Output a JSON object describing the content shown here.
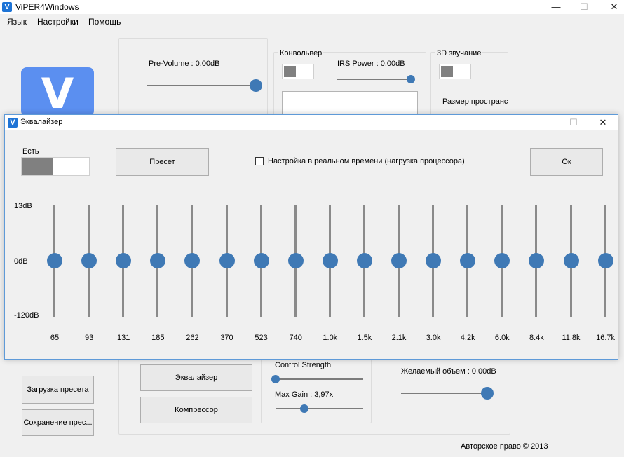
{
  "window": {
    "title": "ViPER4Windows",
    "icon": "V",
    "controls": {
      "minimize": "—",
      "maximize": "☐",
      "close": "✕"
    }
  },
  "menu": [
    "Язык",
    "Настройки",
    "Помощь"
  ],
  "main": {
    "pre_volume_label": "Pre-Volume : 0,00dB",
    "pre_volume_value": 1.0,
    "convolver_label": "Конвольвер",
    "irs_power_label": "IRS Power : 0,00dB",
    "irs_power_value": 1.0,
    "surround_label": "3D звучание",
    "space_size_label": "Размер пространств",
    "control_strength_label": "Control Strength",
    "control_strength_value": 0.0,
    "max_gain_label": "Max Gain : 3,97x",
    "max_gain_value": 0.33,
    "desired_volume_label": "Желаемый объем : 0,00dB",
    "desired_volume_value": 1.0,
    "load_preset_button": "Загрузка пресета",
    "save_preset_button": "Сохранение прес...",
    "equalizer_button": "Эквалайзер",
    "compressor_button": "Компрессор",
    "copyright": "Авторское право © 2013"
  },
  "equalizer": {
    "title": "Эквалайзер",
    "enable_label": "Есть",
    "preset_button": "Пресет",
    "realtime_checkbox_label": "Настройка в реальном времени (нагрузка процессора)",
    "realtime_checked": false,
    "ok_button": "Ок",
    "db_max": "13dB",
    "db_mid": "0dB",
    "db_min": "-120dB",
    "bands": [
      {
        "freq": "65",
        "gain_db": 0
      },
      {
        "freq": "93",
        "gain_db": 0
      },
      {
        "freq": "131",
        "gain_db": 0
      },
      {
        "freq": "185",
        "gain_db": 0
      },
      {
        "freq": "262",
        "gain_db": 0
      },
      {
        "freq": "370",
        "gain_db": 0
      },
      {
        "freq": "523",
        "gain_db": 0
      },
      {
        "freq": "740",
        "gain_db": 0
      },
      {
        "freq": "1.0k",
        "gain_db": 0
      },
      {
        "freq": "1.5k",
        "gain_db": 0
      },
      {
        "freq": "2.1k",
        "gain_db": 0
      },
      {
        "freq": "3.0k",
        "gain_db": 0
      },
      {
        "freq": "4.2k",
        "gain_db": 0
      },
      {
        "freq": "6.0k",
        "gain_db": 0
      },
      {
        "freq": "8.4k",
        "gain_db": 0
      },
      {
        "freq": "11.8k",
        "gain_db": 0
      },
      {
        "freq": "16.7k",
        "gain_db": 0
      }
    ]
  }
}
